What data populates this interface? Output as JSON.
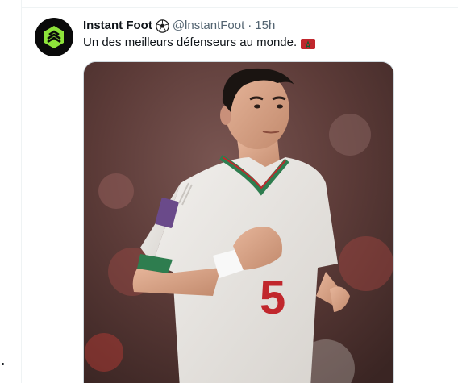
{
  "tweet": {
    "display_name": "Instant Foot",
    "name_emoji": "soccer-ball-icon",
    "handle": "@lnstantFoot",
    "separator": "·",
    "timestamp": "15h",
    "text": "Un des meilleurs défenseurs au monde.",
    "text_emoji": "morocco-flag-icon",
    "avatar_icon": "instant-foot-logo",
    "media": {
      "description_icon": "player-photo",
      "jersey_number": "5"
    }
  },
  "colors": {
    "text_primary": "#0f1419",
    "text_secondary": "#536471",
    "divider": "#eff3f4",
    "avatar_bg": "#0a0a0a",
    "logo_green": "#8ee33a",
    "flag_red": "#c1272d",
    "flag_green": "#006233"
  }
}
